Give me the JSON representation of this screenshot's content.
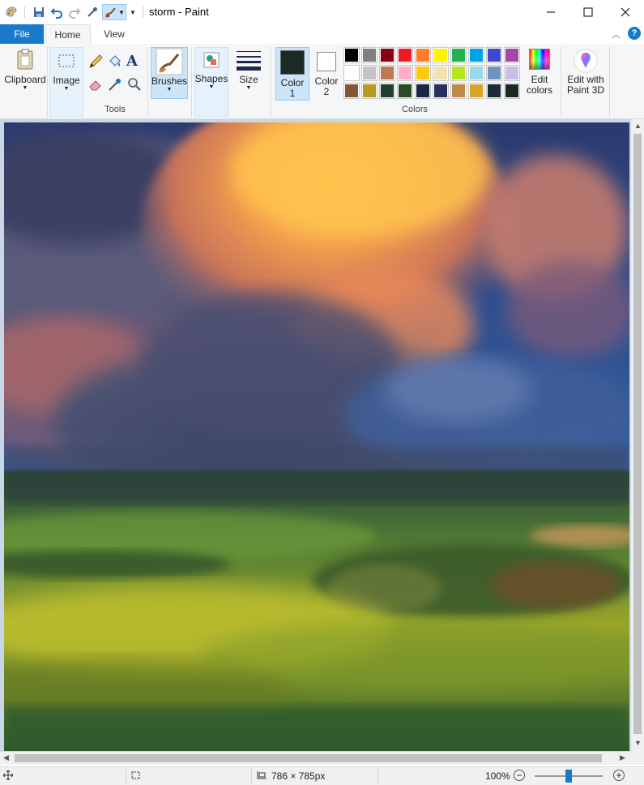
{
  "window": {
    "title": "storm - Paint"
  },
  "menu": {
    "file": "File",
    "tabs": [
      "Home",
      "View"
    ]
  },
  "ribbon": {
    "clipboard": "Clipboard",
    "image": "Image",
    "tools_group": "Tools",
    "brushes": "Brushes",
    "shapes": "Shapes",
    "size": "Size",
    "color1": {
      "label": "Color",
      "num": "1",
      "value": "#1c2a26"
    },
    "color2": {
      "label": "Color",
      "num": "2",
      "value": "#ffffff"
    },
    "colors_group": "Colors",
    "edit_colors": [
      "Edit",
      "colors"
    ],
    "edit_paint3d": [
      "Edit with",
      "Paint 3D"
    ],
    "palette": [
      [
        "#000000",
        "#7f7f7f",
        "#880015",
        "#ed1c24",
        "#ff7f27",
        "#fff200",
        "#22b14c",
        "#00a2e8",
        "#3f48cc",
        "#a349a4"
      ],
      [
        "#ffffff",
        "#c3c3c3",
        "#b97a57",
        "#ffaec9",
        "#ffc90e",
        "#efe4b0",
        "#b5e61d",
        "#99d9ea",
        "#7092be",
        "#c8bfe7"
      ],
      [
        "#845537",
        "#b59b1f",
        "#1f3f2c",
        "#2a4b25",
        "#1a2642",
        "#27305a",
        "#c08a4b",
        "#d7a524",
        "#1e2a3c",
        "#1d2a22"
      ]
    ]
  },
  "status": {
    "dimensions": "786 × 785px",
    "zoom": "100%",
    "zoom_level": 0.5
  }
}
